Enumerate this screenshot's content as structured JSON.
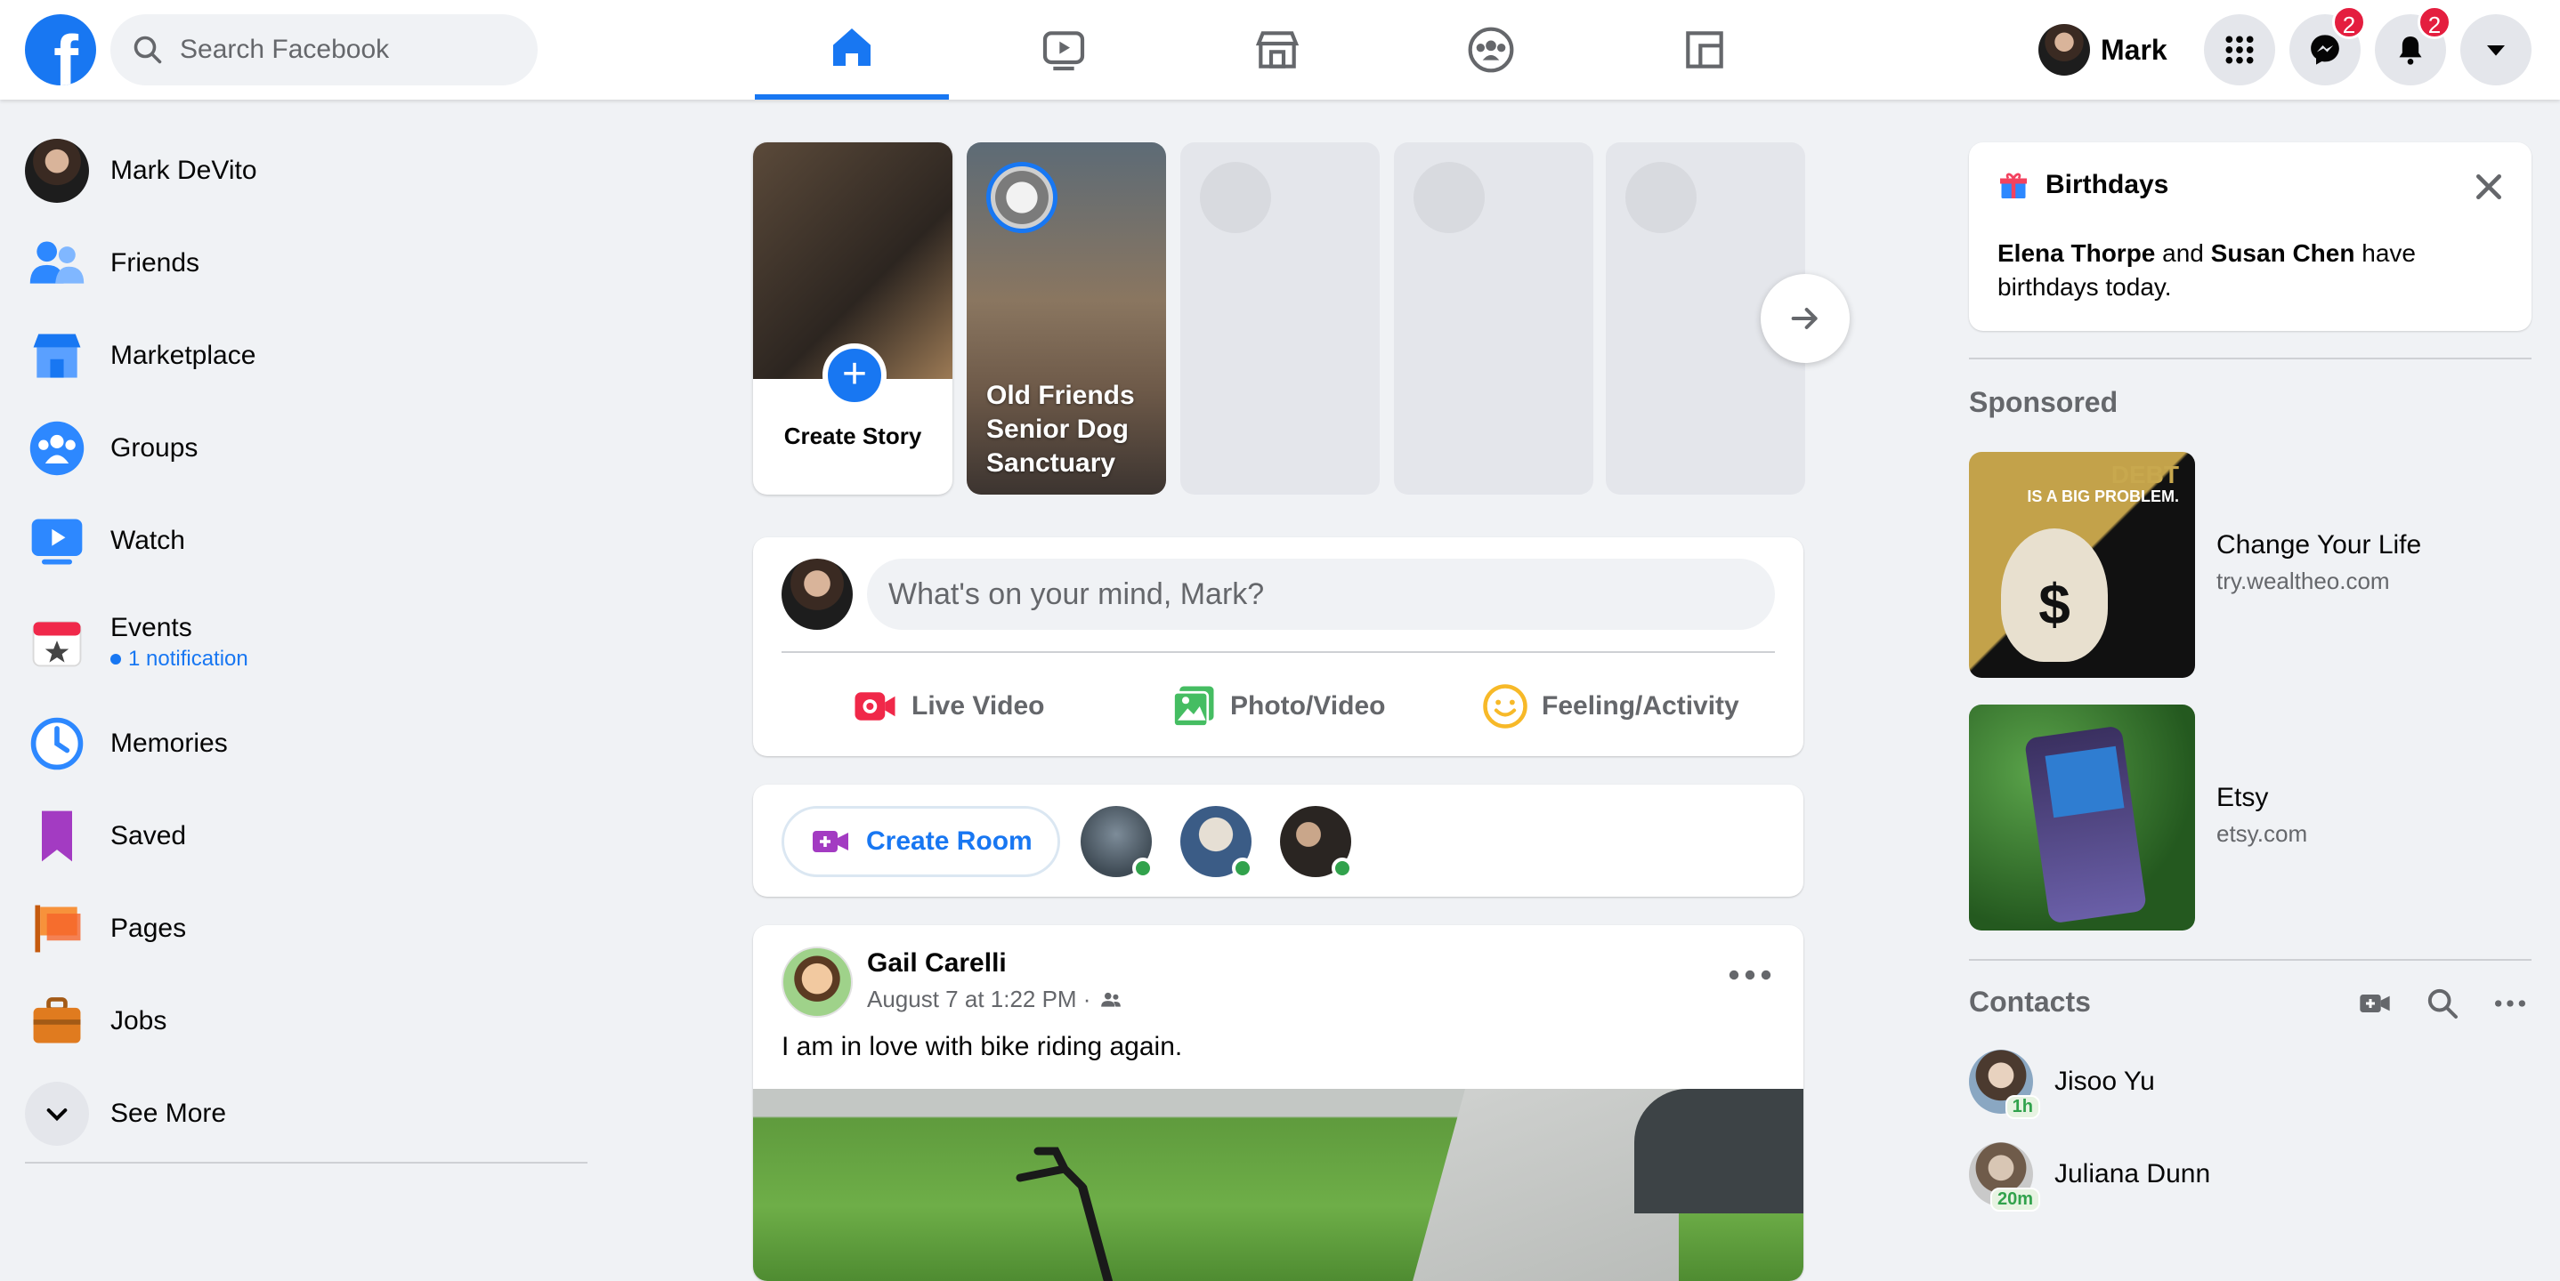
{
  "app": {
    "brand_glyph": "f"
  },
  "search": {
    "placeholder": "Search Facebook"
  },
  "nav_tabs": [
    {
      "name": "home",
      "active": true
    },
    {
      "name": "watch",
      "active": false
    },
    {
      "name": "marketplace",
      "active": false
    },
    {
      "name": "groups",
      "active": false
    },
    {
      "name": "gaming",
      "active": false
    }
  ],
  "header": {
    "profile_name": "Mark",
    "messenger_badge": "2",
    "notifications_badge": "2"
  },
  "sidebar": {
    "items": [
      {
        "label": "Mark DeVito"
      },
      {
        "label": "Friends"
      },
      {
        "label": "Marketplace"
      },
      {
        "label": "Groups"
      },
      {
        "label": "Watch"
      },
      {
        "label": "Events",
        "sub": "1 notification"
      },
      {
        "label": "Memories"
      },
      {
        "label": "Saved"
      },
      {
        "label": "Pages"
      },
      {
        "label": "Jobs"
      },
      {
        "label": "See More"
      }
    ]
  },
  "stories": {
    "create_label": "Create Story",
    "friend_story": "Old Friends Senior Dog Sanctuary"
  },
  "composer": {
    "placeholder": "What's on your mind, Mark?",
    "live_video": "Live Video",
    "photo_video": "Photo/Video",
    "feeling": "Feeling/Activity"
  },
  "rooms": {
    "create_room": "Create Room"
  },
  "post": {
    "author": "Gail Carelli",
    "time": "August 7 at 1:22 PM ·",
    "text": "I am in love with bike riding again."
  },
  "birthdays": {
    "title": "Birthdays",
    "name1": "Elena Thorpe",
    "and": " and ",
    "name2": "Susan Chen",
    "rest": " have birthdays today."
  },
  "sponsored": {
    "title": "Sponsored",
    "ads": [
      {
        "title": "Change Your Life",
        "url": "try.wealtheo.com",
        "img_top": "DEBT",
        "img_sub": "IS A BIG PROBLEM."
      },
      {
        "title": "Etsy",
        "url": "etsy.com"
      }
    ]
  },
  "contacts": {
    "title": "Contacts",
    "items": [
      {
        "name": "Jisoo Yu",
        "time": "1h"
      },
      {
        "name": "Juliana Dunn",
        "time": "20m"
      }
    ]
  },
  "colors": {
    "accent": "#1877f2",
    "badge": "#e41e3f",
    "online": "#31a24c"
  }
}
